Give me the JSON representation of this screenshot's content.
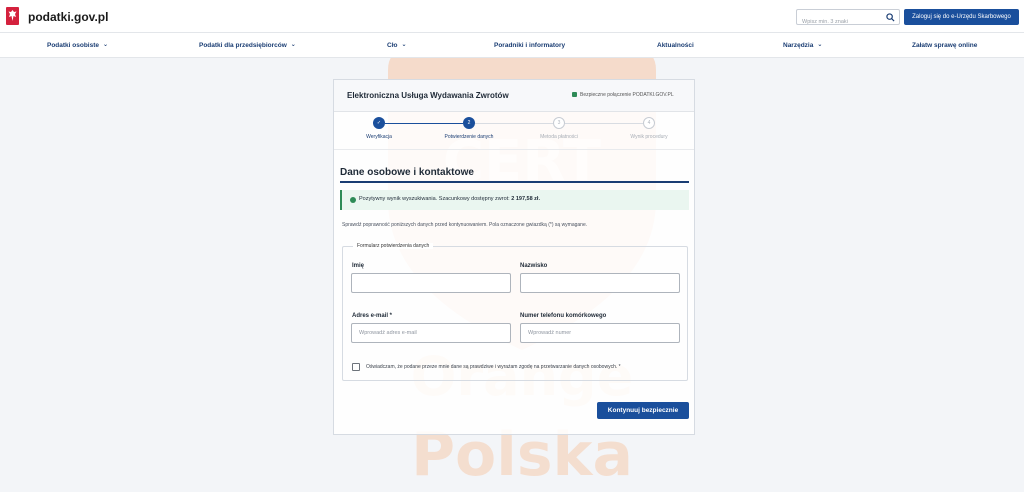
{
  "header": {
    "brand": "podatki.gov.pl",
    "search_placeholder": "Wpisz min. 3 znaki",
    "login_label": "Zaloguj się do e-Urzędu Skarbowego"
  },
  "nav": {
    "items": [
      {
        "label": "Podatki osobiste",
        "has_dropdown": true
      },
      {
        "label": "Podatki dla przedsiębiorców",
        "has_dropdown": true
      },
      {
        "label": "Cło",
        "has_dropdown": true
      },
      {
        "label": "Poradniki i informatory",
        "has_dropdown": false
      },
      {
        "label": "Aktualności",
        "has_dropdown": false
      },
      {
        "label": "Narzędzia",
        "has_dropdown": true
      },
      {
        "label": "Załatw sprawę online",
        "has_dropdown": false
      }
    ]
  },
  "card": {
    "title": "Elektroniczna Usługa Wydawania Zwrotów",
    "secure_label": "Bezpieczne połączenie PODATKI.GOV.PL"
  },
  "steps": [
    {
      "number": "✓",
      "label": "Weryfikacja",
      "state": "done"
    },
    {
      "number": "2",
      "label": "Potwierdzenie danych",
      "state": "active"
    },
    {
      "number": "3",
      "label": "Metoda płatności",
      "state": "pending"
    },
    {
      "number": "4",
      "label": "Wynik procedury",
      "state": "pending"
    }
  ],
  "form": {
    "section_title": "Dane osobowe i kontaktowe",
    "alert_prefix": "Pozytywny wynik wyszukiwania. Szacunkowy dostępny zwrot:",
    "alert_amount": "2 197,58 zł.",
    "info_text": "Sprawdź poprawność poniższych danych przed kontynuowaniem. Pola oznaczone gwiazdką (*) są wymagane.",
    "legend": "Formularz potwierdzenia danych",
    "fields": {
      "first_name": {
        "label": "Imię",
        "value": "",
        "placeholder": ""
      },
      "last_name": {
        "label": "Nazwisko",
        "value": "",
        "placeholder": ""
      },
      "email": {
        "label": "Adres e-mail *",
        "value": "",
        "placeholder": "Wprowadź adres e-mail"
      },
      "phone": {
        "label": "Numer telefonu komórkowego",
        "value": "",
        "placeholder": "Wprowadź numer"
      }
    },
    "consent_label": "Oświadczam, że podane przeze mnie dane są prawdziwe i wyrażam zgodę na przetwarzanie danych osobowych. *",
    "consent_checked": false,
    "submit_label": "Kontynuuj bezpiecznie"
  },
  "watermark": {
    "line1": "CERT",
    "line2": "Orange",
    "line3": "Polska",
    "color": "#ff6a00"
  },
  "colors": {
    "primary": "#1a4f9c",
    "nav_text": "#1a3d73",
    "success": "#2e8b57",
    "background": "#f3f5f8"
  }
}
